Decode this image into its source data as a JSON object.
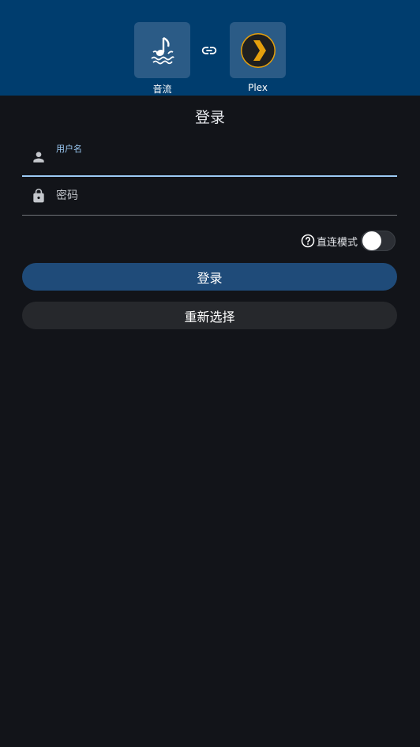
{
  "header": {
    "left_app": {
      "label": "音流",
      "icon": "music-note-water-icon"
    },
    "link_icon": "link-icon",
    "right_app": {
      "label": "Plex",
      "icon": "plex-chevron-icon"
    },
    "colors": {
      "background": "#003d6e",
      "tile": "#2b5b86",
      "plex_orange": "#e5a00d"
    }
  },
  "page_title": "登录",
  "username_field": {
    "label": "用户名",
    "value": "",
    "icon": "person-icon"
  },
  "password_field": {
    "placeholder": "密码",
    "value": "",
    "icon": "lock-icon"
  },
  "direct_mode": {
    "label": "直连模式",
    "help_icon": "help-circle-icon",
    "enabled": false
  },
  "buttons": {
    "login": "登录",
    "reselect": "重新选择"
  },
  "colors": {
    "page_background": "#121419",
    "accent": "#9ccaf4",
    "primary_button": "#1f4b79",
    "secondary_button": "#26282c"
  }
}
